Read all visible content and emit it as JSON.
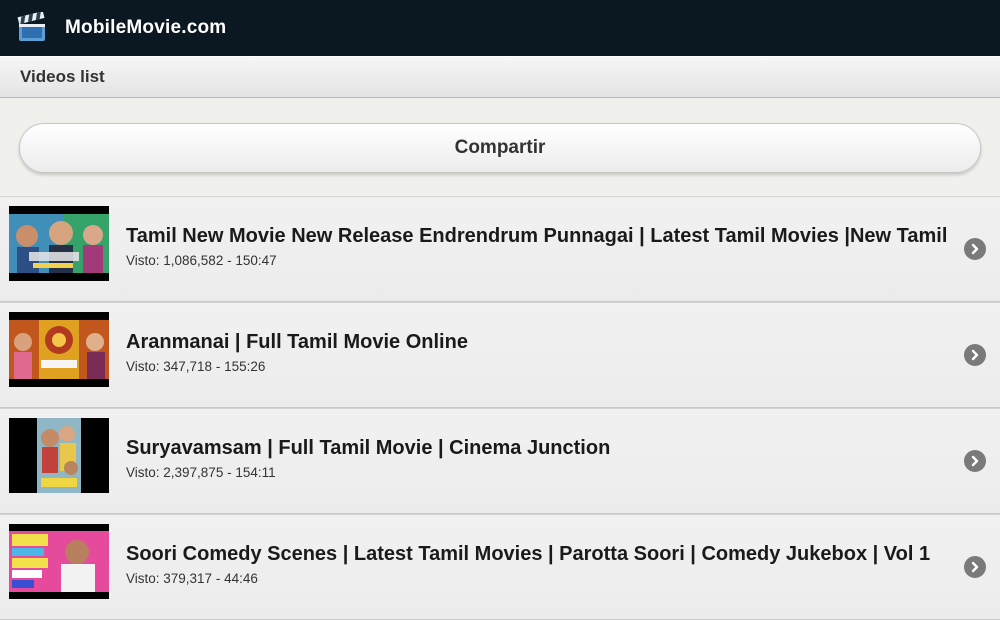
{
  "header": {
    "title": "MobileMovie.com",
    "logo_icon": "clapperboard-icon"
  },
  "subheader": {
    "title": "Videos list"
  },
  "share_button": {
    "label": "Compartir"
  },
  "videos": [
    {
      "title": "Tamil New Movie New Release Endrendrum Punnagai | Latest Tamil Movies |New Tamil Movies",
      "meta": "Visto: 1,086,582 - 150:47"
    },
    {
      "title": "Aranmanai | Full Tamil Movie Online",
      "meta": "Visto: 347,718 - 155:26"
    },
    {
      "title": "Suryavamsam | Full Tamil Movie | Cinema Junction",
      "meta": "Visto: 2,397,875 - 154:11"
    },
    {
      "title": "Soori Comedy Scenes | Latest Tamil Movies | Parotta Soori | Comedy Jukebox | Vol 1",
      "meta": "Visto: 379,317 - 44:46"
    }
  ]
}
